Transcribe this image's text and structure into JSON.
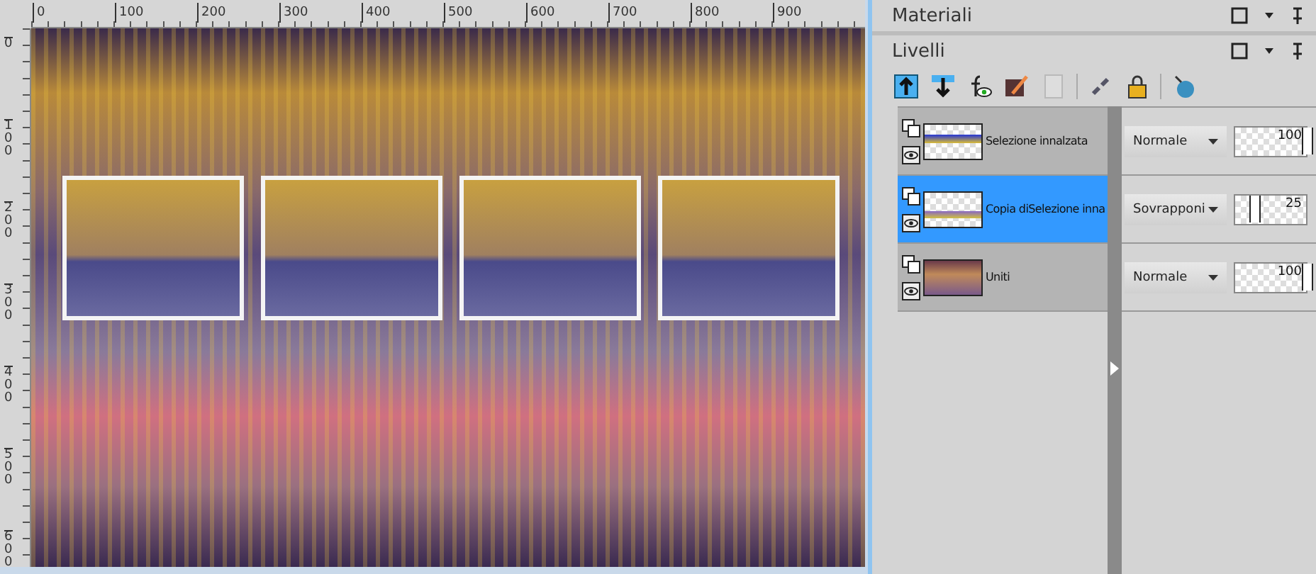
{
  "rulers": {
    "horizontal": [
      "0",
      "100",
      "200",
      "300",
      "400",
      "500",
      "600",
      "700",
      "800",
      "900"
    ],
    "vertical": [
      "0",
      "100",
      "200",
      "300",
      "400",
      "500",
      "600"
    ]
  },
  "panels": [
    {
      "title": "Materiali"
    },
    {
      "title": "Livelli"
    }
  ],
  "layer_tools": [
    {
      "kind": "up",
      "disabled": false
    },
    {
      "kind": "down",
      "disabled": false
    },
    {
      "kind": "fx",
      "disabled": false
    },
    {
      "kind": "brush",
      "disabled": false
    },
    {
      "kind": "page",
      "disabled": true
    },
    {
      "kind": "link",
      "disabled": false
    },
    {
      "kind": "lock",
      "disabled": false
    },
    {
      "kind": "globe",
      "disabled": false
    }
  ],
  "layers": [
    {
      "name": "Selezione innalzata",
      "blend_mode": "Normale",
      "opacity": "100",
      "level": 1,
      "selected": false,
      "kind": "selection"
    },
    {
      "name": "Copia diSelezione inna",
      "blend_mode": "Sovrapponi",
      "opacity": "25",
      "level": 0.25,
      "selected": true,
      "kind": "copy"
    },
    {
      "name": "Uniti",
      "blend_mode": "Normale",
      "opacity": "100",
      "level": 1,
      "selected": false,
      "kind": "merged"
    }
  ]
}
